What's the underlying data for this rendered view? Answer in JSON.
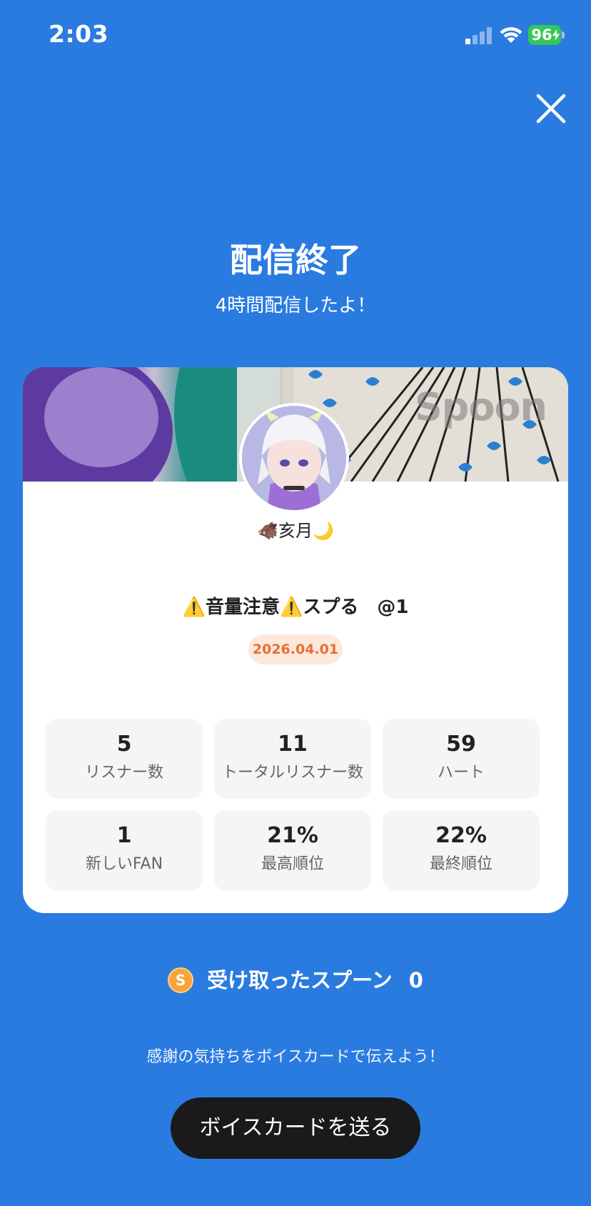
{
  "status_bar": {
    "time": "2:03",
    "battery": "96"
  },
  "header": {
    "title": "配信終了",
    "subtitle": "4時間配信したよ！",
    "close_icon": "close-icon"
  },
  "card": {
    "banner_logo": "Spoon",
    "username": "🐗亥月🌙",
    "stream_title": "⚠️音量注意⚠️スプる　@1",
    "date": "2026.04.01",
    "stats": [
      {
        "value": "5",
        "label": "リスナー数"
      },
      {
        "value": "11",
        "label": "トータルリスナー数"
      },
      {
        "value": "59",
        "label": "ハート"
      },
      {
        "value": "1",
        "label": "新しいFAN"
      },
      {
        "value": "21%",
        "label": "最高順位"
      },
      {
        "value": "22%",
        "label": "最終順位"
      }
    ]
  },
  "spoon": {
    "icon_letter": "S",
    "label": "受け取ったスプーン",
    "count": "0"
  },
  "footer": {
    "thanks_text": "感謝の気持ちをボイスカードで伝えよう！",
    "button_label": "ボイスカードを送る"
  },
  "colors": {
    "background": "#2a7be0",
    "badge_text": "#e8702f",
    "badge_bg": "#fde8dc",
    "button_bg": "#1a1a1a",
    "battery": "#34c759"
  }
}
